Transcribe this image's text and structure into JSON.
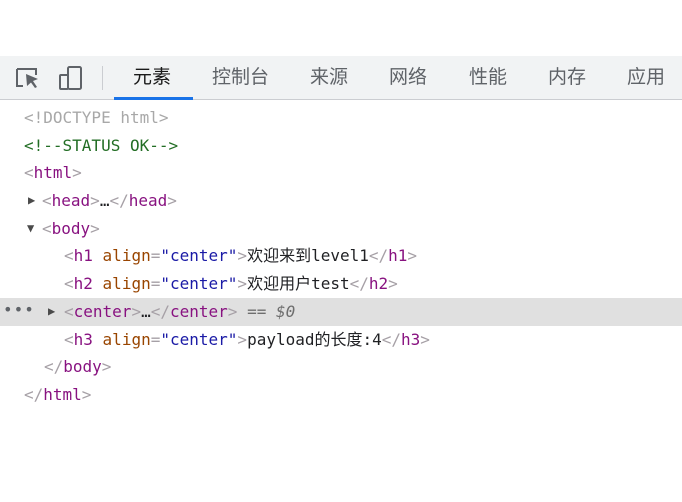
{
  "toolbar": {
    "icons": [
      "inspect-element-icon",
      "device-toolbar-icon"
    ],
    "tabs": [
      {
        "label": "元素",
        "active": true
      },
      {
        "label": "控制台",
        "active": false
      },
      {
        "label": "来源",
        "active": false
      },
      {
        "label": "网络",
        "active": false
      },
      {
        "label": "性能",
        "active": false
      },
      {
        "label": "内存",
        "active": false
      },
      {
        "label": "应用",
        "active": false
      }
    ],
    "accent_color": "#1a73e8"
  },
  "dom": {
    "doctype": "<!DOCTYPE html>",
    "comment": "<!--STATUS OK-->",
    "html_tag": "html",
    "head_tag": "head",
    "body_tag": "body",
    "center_tag": "center",
    "ellipsis": "…",
    "h1": {
      "tag": "h1",
      "attr": "align",
      "value": "\"center\"",
      "text": "欢迎来到level1"
    },
    "h2": {
      "tag": "h2",
      "attr": "align",
      "value": "\"center\"",
      "text": "欢迎用户test"
    },
    "h3": {
      "tag": "h3",
      "attr": "align",
      "value": "\"center\"",
      "text": "payload的长度:4"
    },
    "selected_marker": "== $0",
    "row_menu": "•••"
  }
}
